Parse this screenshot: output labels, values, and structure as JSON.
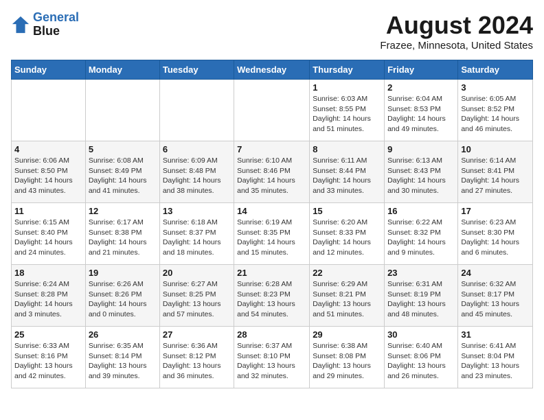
{
  "header": {
    "logo_line1": "General",
    "logo_line2": "Blue",
    "title": "August 2024",
    "subtitle": "Frazee, Minnesota, United States"
  },
  "days_of_week": [
    "Sunday",
    "Monday",
    "Tuesday",
    "Wednesday",
    "Thursday",
    "Friday",
    "Saturday"
  ],
  "weeks": [
    [
      {
        "day": "",
        "info": ""
      },
      {
        "day": "",
        "info": ""
      },
      {
        "day": "",
        "info": ""
      },
      {
        "day": "",
        "info": ""
      },
      {
        "day": "1",
        "info": "Sunrise: 6:03 AM\nSunset: 8:55 PM\nDaylight: 14 hours\nand 51 minutes."
      },
      {
        "day": "2",
        "info": "Sunrise: 6:04 AM\nSunset: 8:53 PM\nDaylight: 14 hours\nand 49 minutes."
      },
      {
        "day": "3",
        "info": "Sunrise: 6:05 AM\nSunset: 8:52 PM\nDaylight: 14 hours\nand 46 minutes."
      }
    ],
    [
      {
        "day": "4",
        "info": "Sunrise: 6:06 AM\nSunset: 8:50 PM\nDaylight: 14 hours\nand 43 minutes."
      },
      {
        "day": "5",
        "info": "Sunrise: 6:08 AM\nSunset: 8:49 PM\nDaylight: 14 hours\nand 41 minutes."
      },
      {
        "day": "6",
        "info": "Sunrise: 6:09 AM\nSunset: 8:48 PM\nDaylight: 14 hours\nand 38 minutes."
      },
      {
        "day": "7",
        "info": "Sunrise: 6:10 AM\nSunset: 8:46 PM\nDaylight: 14 hours\nand 35 minutes."
      },
      {
        "day": "8",
        "info": "Sunrise: 6:11 AM\nSunset: 8:44 PM\nDaylight: 14 hours\nand 33 minutes."
      },
      {
        "day": "9",
        "info": "Sunrise: 6:13 AM\nSunset: 8:43 PM\nDaylight: 14 hours\nand 30 minutes."
      },
      {
        "day": "10",
        "info": "Sunrise: 6:14 AM\nSunset: 8:41 PM\nDaylight: 14 hours\nand 27 minutes."
      }
    ],
    [
      {
        "day": "11",
        "info": "Sunrise: 6:15 AM\nSunset: 8:40 PM\nDaylight: 14 hours\nand 24 minutes."
      },
      {
        "day": "12",
        "info": "Sunrise: 6:17 AM\nSunset: 8:38 PM\nDaylight: 14 hours\nand 21 minutes."
      },
      {
        "day": "13",
        "info": "Sunrise: 6:18 AM\nSunset: 8:37 PM\nDaylight: 14 hours\nand 18 minutes."
      },
      {
        "day": "14",
        "info": "Sunrise: 6:19 AM\nSunset: 8:35 PM\nDaylight: 14 hours\nand 15 minutes."
      },
      {
        "day": "15",
        "info": "Sunrise: 6:20 AM\nSunset: 8:33 PM\nDaylight: 14 hours\nand 12 minutes."
      },
      {
        "day": "16",
        "info": "Sunrise: 6:22 AM\nSunset: 8:32 PM\nDaylight: 14 hours\nand 9 minutes."
      },
      {
        "day": "17",
        "info": "Sunrise: 6:23 AM\nSunset: 8:30 PM\nDaylight: 14 hours\nand 6 minutes."
      }
    ],
    [
      {
        "day": "18",
        "info": "Sunrise: 6:24 AM\nSunset: 8:28 PM\nDaylight: 14 hours\nand 3 minutes."
      },
      {
        "day": "19",
        "info": "Sunrise: 6:26 AM\nSunset: 8:26 PM\nDaylight: 14 hours\nand 0 minutes."
      },
      {
        "day": "20",
        "info": "Sunrise: 6:27 AM\nSunset: 8:25 PM\nDaylight: 13 hours\nand 57 minutes."
      },
      {
        "day": "21",
        "info": "Sunrise: 6:28 AM\nSunset: 8:23 PM\nDaylight: 13 hours\nand 54 minutes."
      },
      {
        "day": "22",
        "info": "Sunrise: 6:29 AM\nSunset: 8:21 PM\nDaylight: 13 hours\nand 51 minutes."
      },
      {
        "day": "23",
        "info": "Sunrise: 6:31 AM\nSunset: 8:19 PM\nDaylight: 13 hours\nand 48 minutes."
      },
      {
        "day": "24",
        "info": "Sunrise: 6:32 AM\nSunset: 8:17 PM\nDaylight: 13 hours\nand 45 minutes."
      }
    ],
    [
      {
        "day": "25",
        "info": "Sunrise: 6:33 AM\nSunset: 8:16 PM\nDaylight: 13 hours\nand 42 minutes."
      },
      {
        "day": "26",
        "info": "Sunrise: 6:35 AM\nSunset: 8:14 PM\nDaylight: 13 hours\nand 39 minutes."
      },
      {
        "day": "27",
        "info": "Sunrise: 6:36 AM\nSunset: 8:12 PM\nDaylight: 13 hours\nand 36 minutes."
      },
      {
        "day": "28",
        "info": "Sunrise: 6:37 AM\nSunset: 8:10 PM\nDaylight: 13 hours\nand 32 minutes."
      },
      {
        "day": "29",
        "info": "Sunrise: 6:38 AM\nSunset: 8:08 PM\nDaylight: 13 hours\nand 29 minutes."
      },
      {
        "day": "30",
        "info": "Sunrise: 6:40 AM\nSunset: 8:06 PM\nDaylight: 13 hours\nand 26 minutes."
      },
      {
        "day": "31",
        "info": "Sunrise: 6:41 AM\nSunset: 8:04 PM\nDaylight: 13 hours\nand 23 minutes."
      }
    ]
  ]
}
